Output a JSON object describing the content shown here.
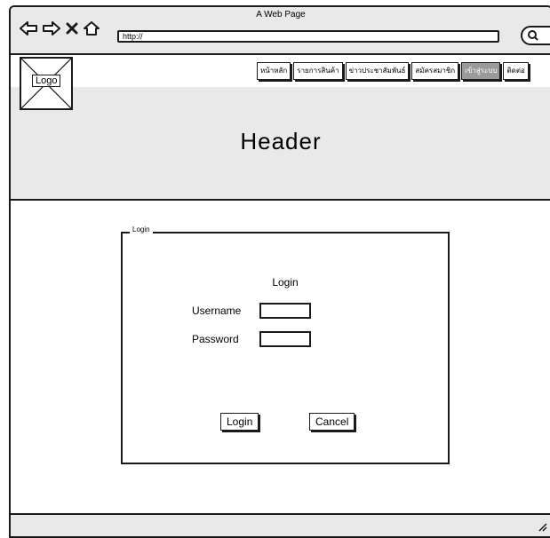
{
  "window": {
    "title": "A Web Page",
    "address": "http://"
  },
  "logo": {
    "label": "Logo"
  },
  "menu": [
    {
      "label": "หน้าหลัก",
      "active": false
    },
    {
      "label": "รายการสินค้า",
      "active": false
    },
    {
      "label": "ข่าวประชาสัมพันธ์",
      "active": false
    },
    {
      "label": "สมัครสมาชิก",
      "active": false
    },
    {
      "label": "เข้าสู่ระบบ",
      "active": true
    },
    {
      "label": "ติดต่อ",
      "active": false
    }
  ],
  "header": {
    "text": "Header"
  },
  "login": {
    "legend": "Login",
    "title": "Login",
    "username_label": "Username",
    "username_value": "",
    "password_label": "Password",
    "password_value": "",
    "login_button": "Login",
    "cancel_button": "Cancel"
  },
  "icons": {
    "back": "back-arrow-icon",
    "forward": "forward-arrow-icon",
    "stop": "close-icon",
    "home": "home-icon",
    "search": "search-icon",
    "resize": "resize-grip-icon"
  }
}
